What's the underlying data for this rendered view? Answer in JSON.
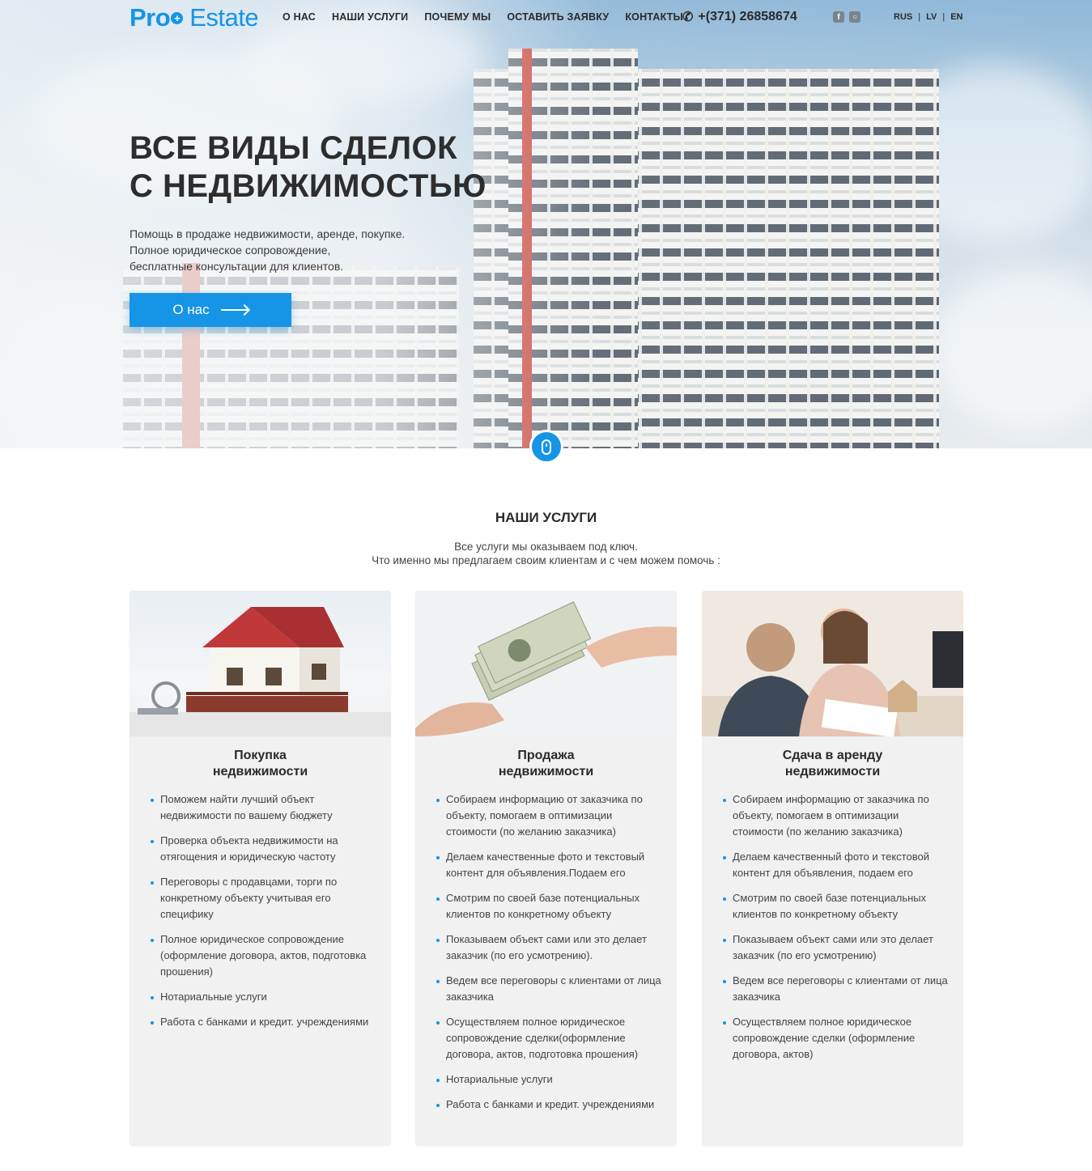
{
  "brand": {
    "logo_part1": "Pro",
    "logo_part2": "Estate",
    "accent_color": "#1694e6"
  },
  "nav": {
    "items": [
      "О НАС",
      "НАШИ УСЛУГИ",
      "ПОЧЕМУ МЫ",
      "ОСТАВИТЬ ЗАЯВКУ",
      "КОНТАКТЫ"
    ],
    "phone": "+(371) 26858674",
    "phone_icon": "phone-icon",
    "social": [
      "facebook-icon",
      "instagram-icon"
    ],
    "languages": [
      "RUS",
      "LV",
      "EN"
    ]
  },
  "hero": {
    "title_line1": "ВСЕ ВИДЫ СДЕЛОК",
    "title_line2": "С НЕДВИЖИМОСТЬЮ",
    "text_line1": "Помощь в продаже недвижимости, аренде, покупке.",
    "text_line2": "Полное юридическое сопровождение,",
    "text_line3": "бесплатные консультации для клиентов.",
    "button_label": "О нас"
  },
  "services": {
    "title": "НАШИ УСЛУГИ",
    "subtitle_line1": "Все услуги мы оказываем под ключ.",
    "subtitle_line2": "Что именно мы предлагаем своим клиентам и с чем можем помочь :",
    "cards": [
      {
        "title_line1": "Покупка",
        "title_line2": "недвижимости",
        "items": [
          "Поможем найти лучший объект недвижимости по вашему бюджету",
          "Проверка объекта недвижимости на отягощения и юридическую частоту",
          "Переговоры с продавцами, торги по конкретному объекту учитывая его специфику",
          "Полное юридическое сопровождение (оформление договора, актов, подготовка прошения)",
          "Нотариальные услуги",
          "Работа с банками и кредит. учреждениями"
        ]
      },
      {
        "title_line1": "Продажа",
        "title_line2": "недвижимости",
        "items": [
          "Собираем информацию от заказчика по объекту, помогаем в оптимизации стоимости (по желанию заказчика)",
          "Делаем качественные фото и текстовый контент для объявления.Подаем его",
          "Смотрим по своей базе потенциальных клиентов по конкретному объекту",
          "Показываем объект сами или это делает заказчик (по его усмотрению).",
          "Ведем все переговоры с клиентами от лица заказчика",
          "Осуществляем полное юридическое сопровождение сделки(оформление договора, актов, подготовка прошения)",
          "Нотариальные услуги",
          "Работа с банками и кредит. учреждениями"
        ]
      },
      {
        "title_line1": "Сдача в аренду",
        "title_line2": "недвижимости",
        "items": [
          "Собираем информацию от заказчика по объекту, помогаем в оптимизации стоимости (по желанию заказчика)",
          "Делаем качественный фото и текстовой контент для объявления, подаем его",
          "Смотрим по своей базе потенциальных клиентов по конкретному объекту",
          "Показываем объект сами или это делает заказчик (по его усмотрению)",
          "Ведем все переговоры с клиентами от лица заказчика",
          "Осуществляем полное юридическое сопровождение сделки (оформление договора, актов)"
        ]
      }
    ]
  }
}
